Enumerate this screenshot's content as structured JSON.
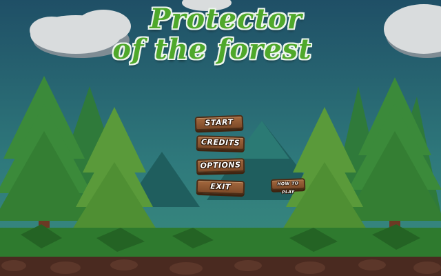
{
  "game": {
    "title_line1": "Protector",
    "title_line2": "of the forest"
  },
  "menu": {
    "start": "Start",
    "credits": "Credits",
    "options": "Options",
    "exit": "Exit",
    "how_to_play": "How to play"
  },
  "colors": {
    "sky": "#245a6b",
    "title_fill": "#4fa82b",
    "title_outline": "#eef6ee",
    "button_wood": "#8b5530",
    "grass": "#2e7a2e",
    "soil": "#4a2a20"
  }
}
